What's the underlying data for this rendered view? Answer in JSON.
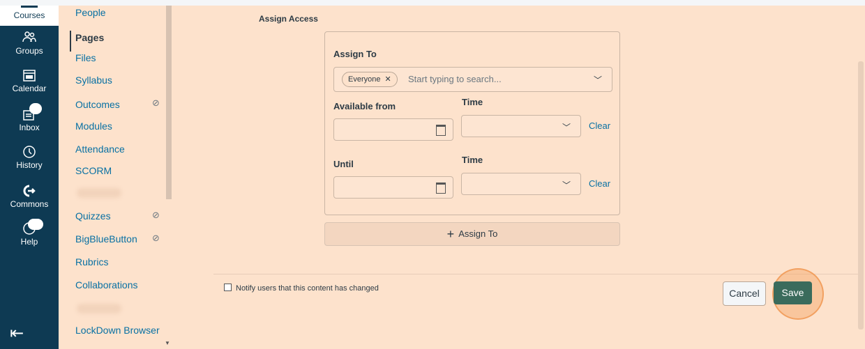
{
  "global_nav": {
    "courses": "Courses",
    "groups": "Groups",
    "calendar": "Calendar",
    "inbox": "Inbox",
    "history": "History",
    "commons": "Commons",
    "help": "Help"
  },
  "course_nav": {
    "items": [
      "People",
      "Pages",
      "Files",
      "Syllabus",
      "Outcomes",
      "Modules",
      "Attendance",
      "SCORM",
      "",
      "Quizzes",
      "BigBlueButton",
      "Rubrics",
      "Collaborations",
      "",
      "LockDown Browser"
    ],
    "active": "Pages"
  },
  "assign": {
    "section_title": "Assign Access",
    "assign_to_label": "Assign To",
    "tag": "Everyone",
    "placeholder": "Start typing to search...",
    "available_from": "Available from",
    "time": "Time",
    "until": "Until",
    "clear": "Clear",
    "assign_button": "Assign To"
  },
  "footer": {
    "notify": "Notify users that this content has changed",
    "cancel": "Cancel",
    "save": "Save"
  }
}
